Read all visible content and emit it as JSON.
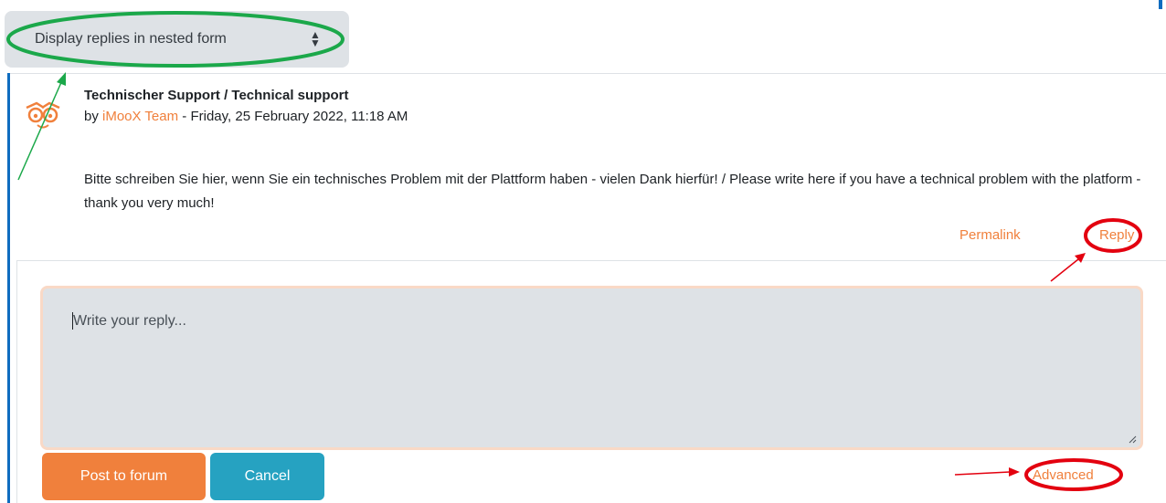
{
  "thread_display": {
    "selected_option": "Display replies in nested form"
  },
  "post": {
    "subject": "Technischer Support / Technical support",
    "by_prefix": "by ",
    "author": "iMooX Team",
    "date_separator": " - ",
    "date": "Friday, 25 February 2022, 11:18 AM",
    "body": "Bitte schreiben Sie hier, wenn Sie ein technisches Problem mit der Plattform haben - vielen Dank hierfür! / Please write here if you have a technical problem with the platform - thank you very much!",
    "actions": {
      "permalink": "Permalink",
      "reply": "Reply"
    }
  },
  "reply_form": {
    "placeholder": "Write your reply...",
    "post_button": "Post to forum",
    "cancel_button": "Cancel",
    "advanced_link": "Advanced"
  },
  "colors": {
    "accent": "#f0803c",
    "secondary": "#26a2c1",
    "nav_bar": "#0f6cbf",
    "annotation_green": "#1ba84a",
    "annotation_red": "#e3000f"
  },
  "icons": {
    "avatar": "owl-eyes-logo-icon",
    "select_caret": "sort-caret-icon",
    "resize": "resize-handle-icon"
  }
}
